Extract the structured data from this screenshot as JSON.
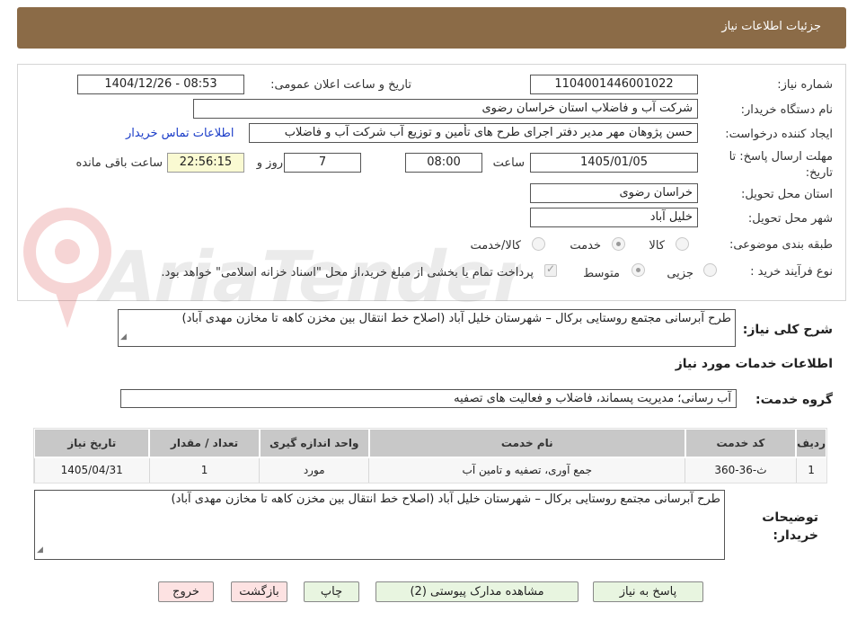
{
  "header": {
    "title": "جزئیات اطلاعات نیاز"
  },
  "form": {
    "need_number_label": "شماره نیاز:",
    "need_number": "1104001446001022",
    "announce_label": "تاریخ و ساعت اعلان عمومی:",
    "announce_value": "1404/12/26 - 08:53",
    "buyer_org_label": "نام دستگاه خریدار:",
    "buyer_org": "شرکت آب و فاضلاب استان خراسان رضوی",
    "requester_label": "ایجاد کننده درخواست:",
    "requester": "حسن پژوهان مهر مدیر دفتر اجرای طرح های تأمین و توزیع آب  شرکت آب و فاضلاب",
    "contact_link": "اطلاعات تماس خریدار",
    "deadline_label": "مهلت ارسال پاسخ: تا تاریخ:",
    "deadline_date": "1405/01/05",
    "time_label": "ساعت",
    "deadline_time": "08:00",
    "days_value": "7",
    "days_label": "روز و",
    "remaining_time": "22:56:15",
    "remaining_label": "ساعت باقی مانده",
    "province_label": "استان محل تحویل:",
    "province": "خراسان رضوی",
    "city_label": "شهر محل تحویل:",
    "city": "خلیل آباد",
    "category_label": "طبقه بندی موضوعی:",
    "category_options": [
      "کالا",
      "خدمت",
      "کالا/خدمت"
    ],
    "category_selected": "خدمت",
    "process_label": "نوع فرآیند خرید :",
    "process_options": [
      "جزیی",
      "متوسط"
    ],
    "process_selected": "متوسط",
    "payment_note": "پرداخت تمام یا بخشی از مبلغ خرید،از محل \"اسناد خزانه اسلامی\" خواهد بود."
  },
  "watermark": {
    "text": "AriaTender.neT"
  },
  "description": {
    "label": "شرح کلی نیاز:",
    "text": "طرح آبرسانی مجتمع روستایی برکال – شهرستان خلیل آباد (اصلاح خط انتقال بین مخزن کاهه تا مخازن مهدی آباد)"
  },
  "services": {
    "section_title": "اطلاعات خدمات مورد نیاز",
    "group_label": "گروه خدمت:",
    "group_value": "آب رسانی؛ مدیریت پسماند، فاضلاب و فعالیت های تصفیه",
    "columns": [
      "ردیف",
      "کد خدمت",
      "نام خدمت",
      "واحد اندازه گیری",
      "تعداد / مقدار",
      "تاریخ نیاز"
    ],
    "rows": [
      [
        "1",
        "ث-36-360",
        "جمع آوری، تصفیه و تامین آب",
        "مورد",
        "1",
        "1405/04/31"
      ]
    ]
  },
  "buyer_notes": {
    "label": "توضیحات خریدار:",
    "text": "طرح آبرسانی مجتمع روستایی برکال – شهرستان خلیل آباد (اصلاح خط انتقال بین مخزن کاهه تا مخازن مهدی آباد)"
  },
  "buttons": {
    "reply": "پاسخ به نیاز",
    "attachments": "مشاهده مدارک پیوستی (2)",
    "print": "چاپ",
    "back": "بازگشت",
    "exit": "خروج"
  }
}
